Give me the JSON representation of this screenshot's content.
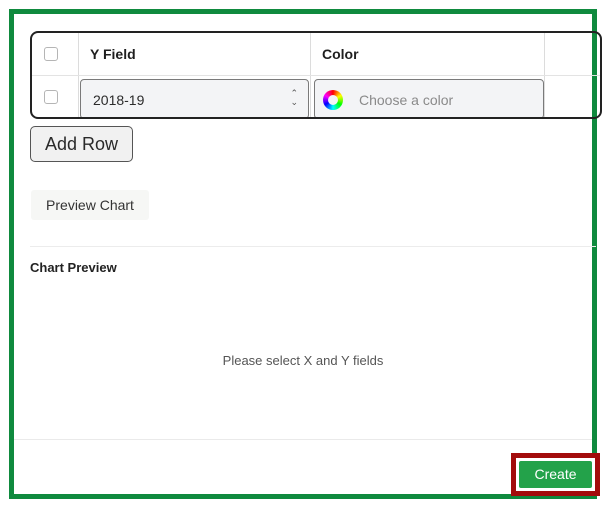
{
  "table": {
    "headers": {
      "y_field": "Y Field",
      "color": "Color"
    },
    "row": {
      "y_field_value": "2018-19",
      "color_placeholder": "Choose a color"
    }
  },
  "buttons": {
    "add_row": "Add Row",
    "preview_chart": "Preview Chart",
    "create": "Create"
  },
  "preview": {
    "heading": "Chart Preview",
    "empty_message": "Please select X and Y fields"
  },
  "colors": {
    "frame_border": "#0f8a3e",
    "highlight_border": "#a30c0c",
    "create_button": "#23a24a"
  }
}
